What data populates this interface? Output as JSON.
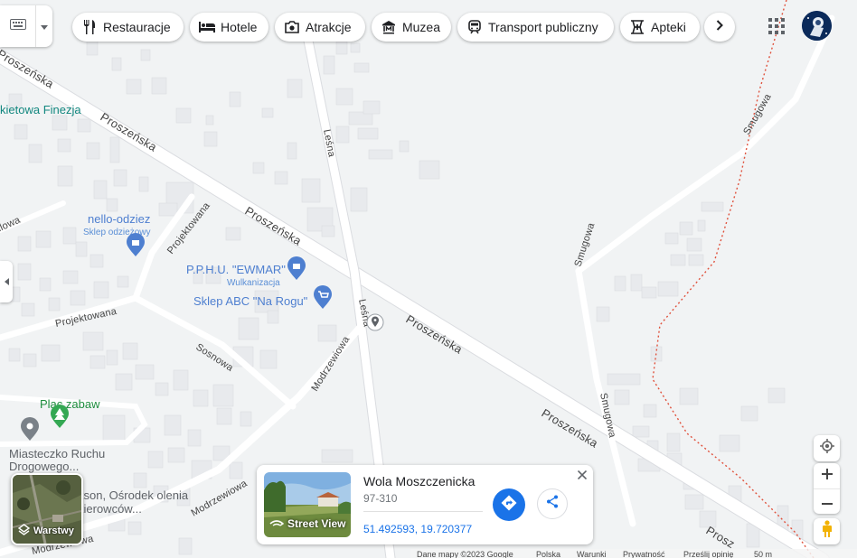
{
  "toolbar": {
    "keyboard_icon": "keyboard-icon",
    "chips": [
      {
        "label": "Restauracje",
        "icon": "restaurant-icon"
      },
      {
        "label": "Hotele",
        "icon": "hotel-icon"
      },
      {
        "label": "Atrakcje",
        "icon": "camera-icon"
      },
      {
        "label": "Muzea",
        "icon": "museum-icon"
      },
      {
        "label": "Transport publiczny",
        "icon": "train-icon"
      },
      {
        "label": "Apteki",
        "icon": "pharmacy-icon"
      }
    ]
  },
  "map": {
    "streets": [
      "Proszeńska",
      "Proszeńska",
      "Proszeńska",
      "Proszeńska",
      "Proszeńska",
      "Prosz",
      "Leśna",
      "Leśna",
      "Smugowa",
      "Smugowa",
      "Smugowa",
      "Projektowana",
      "Projektowana",
      "Sosnowa",
      "Modrzewiowa",
      "Modrzewiowa",
      "Modrzewiowa",
      "dlowa"
    ],
    "pois": [
      {
        "name": "kietowa Finezja",
        "color": "#12877f"
      },
      {
        "name": "nello-odziez",
        "subtitle": "Sklep odzieżowy",
        "color": "#4e7fd0"
      },
      {
        "name": "P.P.H.U. \"EWMAR\"",
        "subtitle": "Wulkanizacja",
        "color": "#4e7fd0"
      },
      {
        "name": "Sklep ABC \"Na Rogu\"",
        "color": "#4e7fd0"
      },
      {
        "name": "Plac zabaw",
        "color": "#1e8e3e"
      },
      {
        "name": "Miasteczko Ruchu Drogowego...",
        "color": "#5f6368"
      },
      {
        "name": "kson, Ośrodek olenia kierowców...",
        "color": "#5f6368"
      }
    ]
  },
  "layers": {
    "label": "Warstwy"
  },
  "place_card": {
    "title": "Wola Moszczenicka",
    "postal": "97-310",
    "coordinates": "51.492593, 19.720377",
    "street_view_label": "Street View"
  },
  "footer": {
    "items": [
      "Dane mapy ©2023 Google",
      "Polska",
      "Warunki",
      "Prywatność",
      "Prześlij opinię",
      "50 m"
    ]
  },
  "colors": {
    "accent": "#1a73e8",
    "road": "#ffffff",
    "background": "#f1f3f4",
    "building": "#e8eaed",
    "boundary": "#e0523d"
  }
}
